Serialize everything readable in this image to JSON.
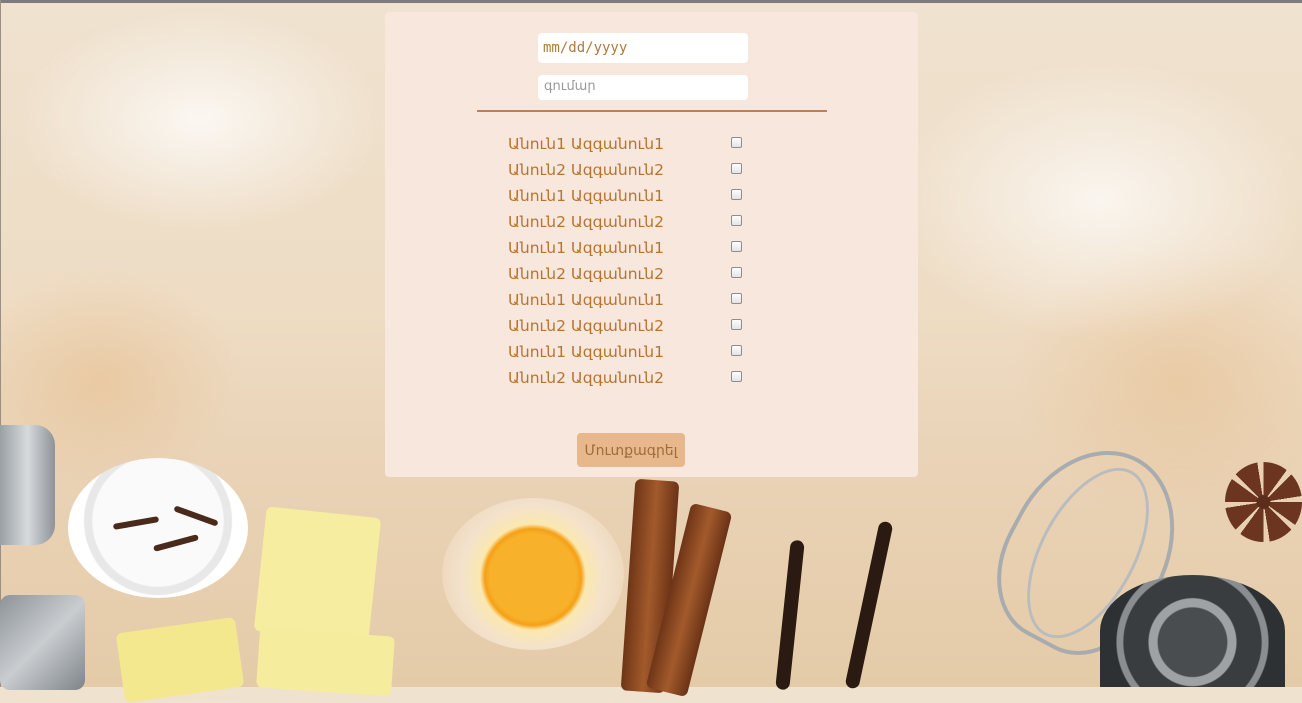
{
  "form": {
    "date_placeholder": "mm/dd/yyyy",
    "amount_placeholder": "գումար",
    "submit_label": "Մուտքագրել"
  },
  "people": [
    {
      "label": "Անուն1 Ազգանուն1",
      "checked": false
    },
    {
      "label": "Անուն2 Ազգանուն2",
      "checked": false
    },
    {
      "label": "Անուն1 Ազգանուն1",
      "checked": false
    },
    {
      "label": "Անուն2 Ազգանուն2",
      "checked": false
    },
    {
      "label": "Անուն1 Ազգանուն1",
      "checked": false
    },
    {
      "label": "Անուն2 Ազգանուն2",
      "checked": false
    },
    {
      "label": "Անուն1 Ազգանուն1",
      "checked": false
    },
    {
      "label": "Անուն2 Ազգանուն2",
      "checked": false
    },
    {
      "label": "Անուն1 Ազգանուն1",
      "checked": false
    },
    {
      "label": "Անուն2 Ազգանուն2",
      "checked": false
    }
  ],
  "colors": {
    "panel_bg": "#f8e7dd",
    "text_accent": "#b8742f",
    "button_bg": "#e6b88c",
    "divider": "#b8835a"
  },
  "background_icons": [
    "cupcake-liner-icon",
    "clove-icon",
    "butter-icon",
    "egg-icon",
    "cinnamon-stick-icon",
    "vanilla-bean-icon",
    "whisk-icon",
    "measuring-spoon-icon",
    "star-anise-icon",
    "baking-tin-icon"
  ]
}
